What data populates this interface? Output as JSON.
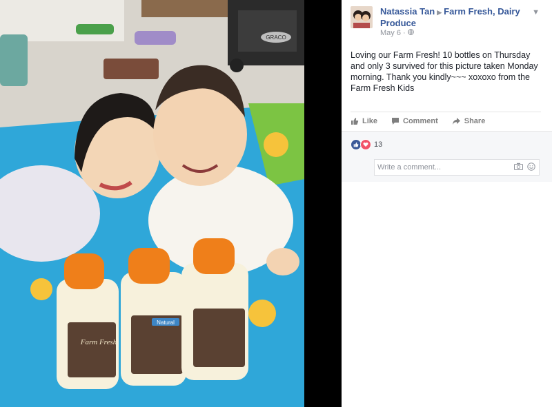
{
  "post": {
    "author": "Natassia Tan",
    "page": "Farm Fresh, Dairy Produce",
    "date": "May 6",
    "text": "Loving our Farm Fresh! 10 bottles on Thursday and only 3 survived for this picture taken Monday morning. Thank you kindly~~~ xoxoxo from the Farm Fresh Kids"
  },
  "actions": {
    "like": "Like",
    "comment": "Comment",
    "share": "Share"
  },
  "reactions": {
    "count": "13"
  },
  "comment_input": {
    "placeholder": "Write a comment..."
  },
  "photo": {
    "playpen_brand": "GRACO",
    "bottle_brand": "Farm Fresh",
    "bottle_badge": "Natural"
  },
  "colors": {
    "link": "#365899",
    "like_blue": "#3b5998",
    "love_red": "#f25268",
    "cap_orange": "#ef7f1a"
  }
}
